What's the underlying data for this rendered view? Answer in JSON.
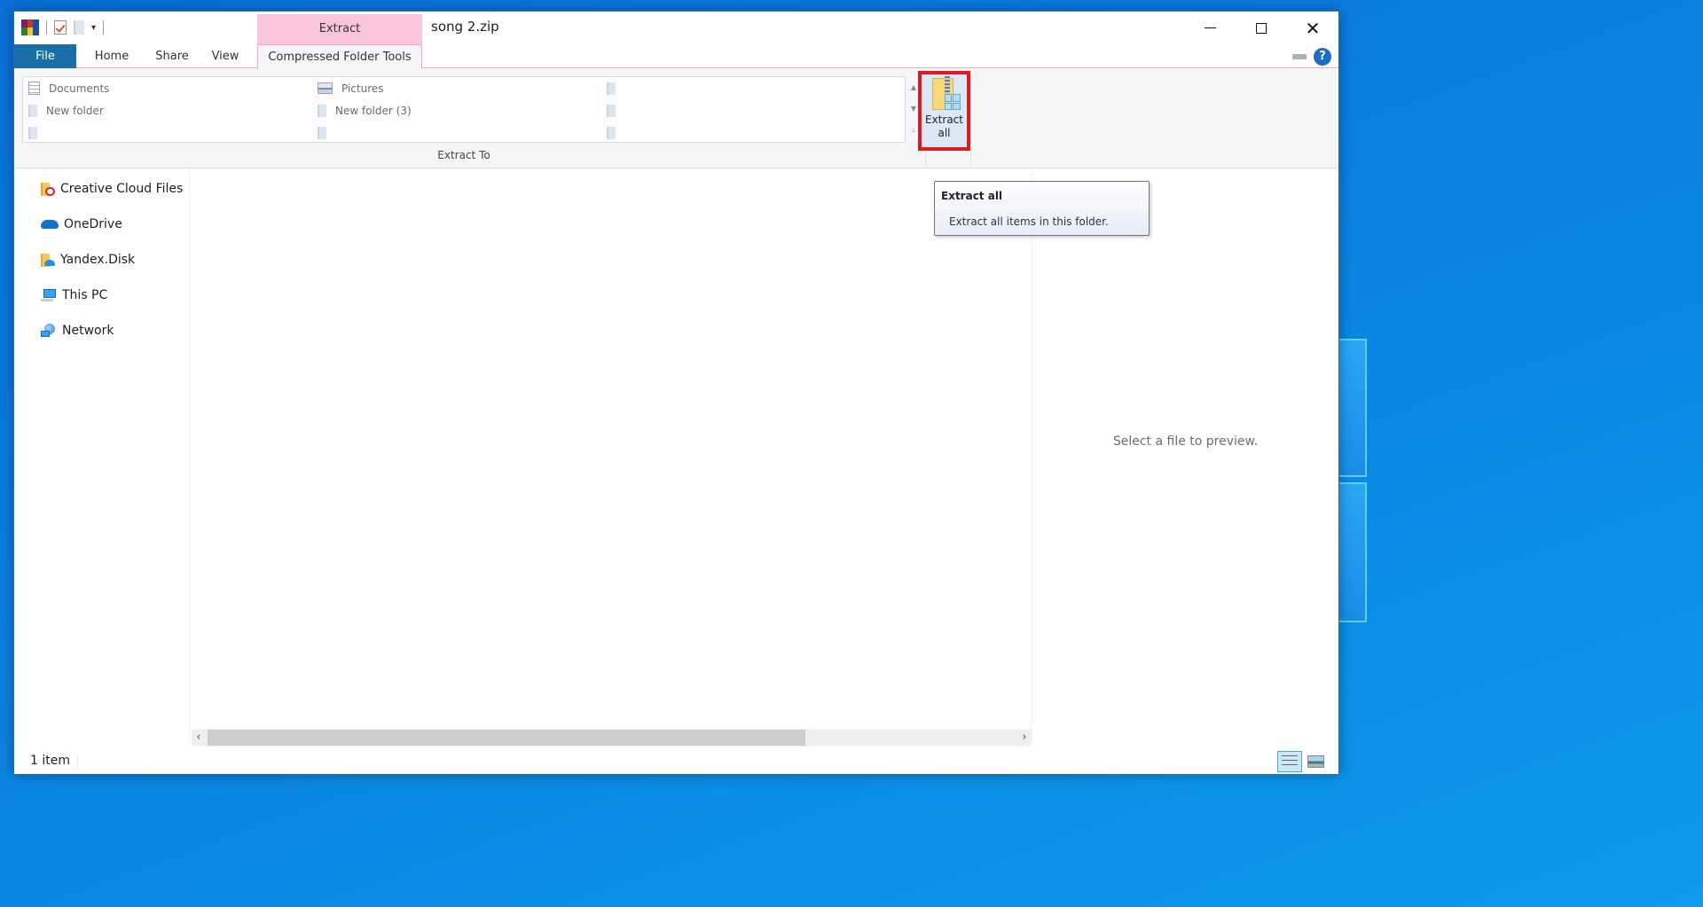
{
  "window": {
    "title": "song 2.zip",
    "context_tab_header": "Extract",
    "controls": {
      "minimize": "minimize",
      "maximize": "maximize",
      "close": "close"
    }
  },
  "quick_access_toolbar": {
    "icons": [
      "winrar-app-icon",
      "properties-check-icon",
      "new-folder-icon",
      "customize-dropdown-icon"
    ],
    "dropdown_glyph": "▾"
  },
  "ribbon": {
    "tabs": [
      {
        "label": "File",
        "active": false
      },
      {
        "label": "Home",
        "active": false
      },
      {
        "label": "Share",
        "active": false
      },
      {
        "label": "View",
        "active": false
      },
      {
        "label": "Compressed Folder Tools",
        "active": true
      }
    ],
    "help_glyph": "?",
    "extract_to": {
      "group_label": "Extract To",
      "columns": [
        [
          {
            "label": "Documents",
            "icon": "documents-icon"
          },
          {
            "label": "New folder",
            "icon": "folder-icon"
          },
          {
            "label": "",
            "icon": "folder-icon"
          }
        ],
        [
          {
            "label": "Pictures",
            "icon": "pictures-icon"
          },
          {
            "label": "New folder (3)",
            "icon": "folder-icon"
          },
          {
            "label": "",
            "icon": "folder-icon"
          }
        ],
        [
          {
            "label": "",
            "icon": "folder-icon"
          },
          {
            "label": "",
            "icon": "folder-icon"
          },
          {
            "label": "",
            "icon": "folder-icon"
          }
        ]
      ],
      "scroll_glyphs": {
        "up": "▲",
        "down": "▼",
        "more": "⩡"
      }
    },
    "extract_all": {
      "label_line1": "Extract",
      "label_line2": "all",
      "highlight_color": "#e0191f"
    }
  },
  "tooltip": {
    "title": "Extract all",
    "description": "Extract all items in this folder."
  },
  "navigation_pane": {
    "items": [
      {
        "label": "Creative Cloud Files",
        "icon": "creative-cloud-folder-icon"
      },
      {
        "label": "OneDrive",
        "icon": "onedrive-cloud-icon"
      },
      {
        "label": "Yandex.Disk",
        "icon": "yandex-disk-folder-icon"
      },
      {
        "label": "This PC",
        "icon": "this-pc-icon"
      },
      {
        "label": "Network",
        "icon": "network-icon"
      }
    ]
  },
  "content": {
    "horizontal_scrollbar": {
      "left_glyph": "‹",
      "right_glyph": "›",
      "visible_fraction": 0.74,
      "position": 0.0
    }
  },
  "preview_pane": {
    "message": "Select a file to preview."
  },
  "status_bar": {
    "item_count": "1 item",
    "view_buttons": [
      {
        "name": "details-view",
        "active": true
      },
      {
        "name": "large-icons-view",
        "active": false
      }
    ]
  },
  "colors": {
    "file_tab": "#1a6fa8",
    "context_tab": "#fbc5de",
    "help_icon": "#1c6dc9",
    "desktop": "#0a7fe0"
  }
}
